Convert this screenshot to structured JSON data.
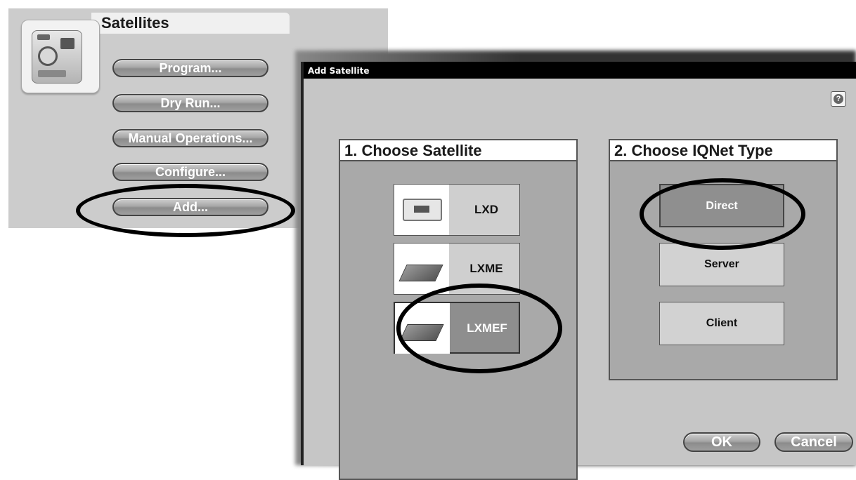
{
  "satellites_panel": {
    "title": "Satellites",
    "buttons": {
      "program": "Program...",
      "dry_run": "Dry Run...",
      "manual_operations": "Manual Operations...",
      "configure": "Configure...",
      "add": "Add..."
    }
  },
  "dialog": {
    "title": "Add Satellite",
    "help_icon": "?",
    "choose_satellite": {
      "title": "1.  Choose Satellite",
      "options": [
        "LXD",
        "LXME",
        "LXMEF"
      ],
      "selected": "LXMEF"
    },
    "choose_iqnet_type": {
      "title": "2.  Choose IQNet Type",
      "options": [
        "Direct",
        "Server",
        "Client"
      ],
      "selected": "Direct"
    },
    "ok_label": "OK",
    "cancel_label": "Cancel"
  },
  "colors": {
    "panel_bg": "#cccccc",
    "dialog_bg": "#c6c6c6",
    "titlebar": "#000000",
    "button_gray": "#9e9e9e",
    "annotation_ring": "#000000"
  }
}
